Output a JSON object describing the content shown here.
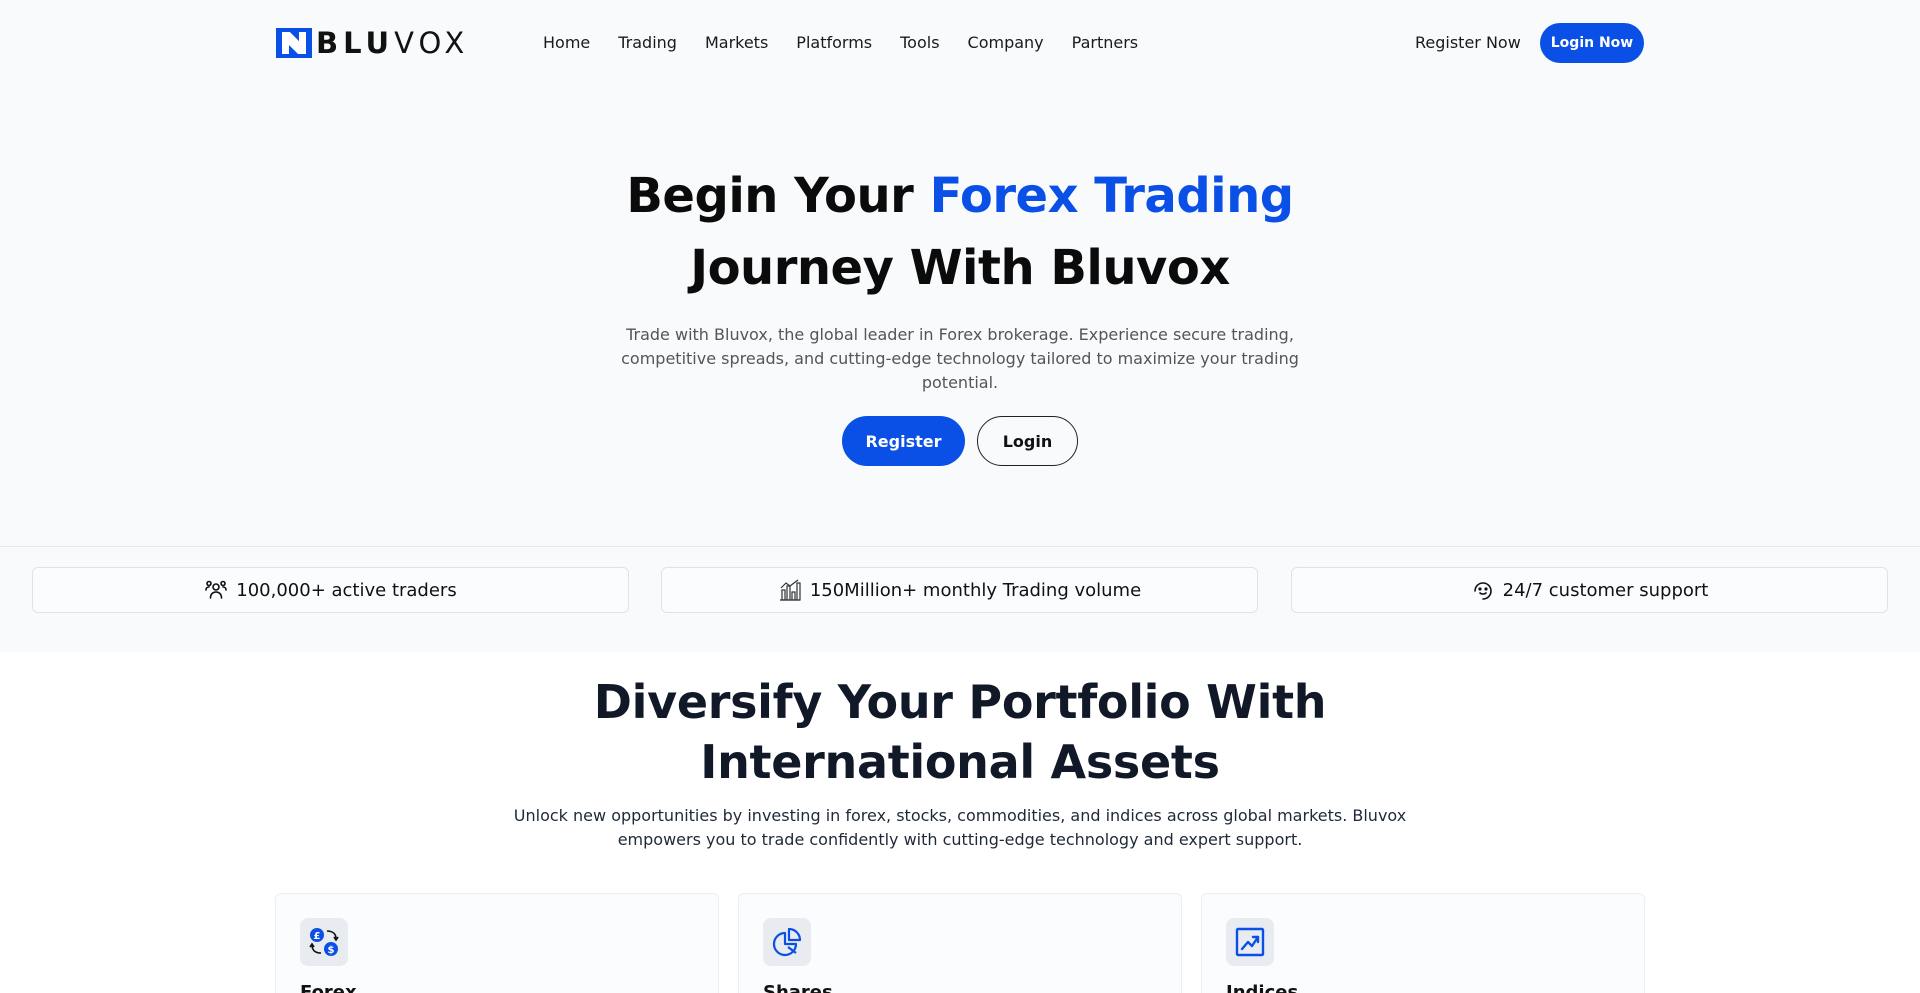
{
  "brand": {
    "name_bold": "BLU",
    "name_light": "VOX"
  },
  "nav": {
    "links": [
      "Home",
      "Trading",
      "Markets",
      "Platforms",
      "Tools",
      "Company",
      "Partners"
    ],
    "register_label": "Register Now",
    "login_label": "Login Now"
  },
  "hero": {
    "title_part1": "Begin Your ",
    "title_accent": "Forex Trading",
    "title_part2": "Journey With Bluvox",
    "subtitle": "Trade with Bluvox, the global leader in Forex brokerage. Experience secure trading, competitive spreads, and cutting-edge technology tailored to maximize your trading potential.",
    "register_label": "Register",
    "login_label": "Login"
  },
  "stats": [
    {
      "icon": "users-icon",
      "text": "100,000+ active traders"
    },
    {
      "icon": "bar-chart-icon",
      "text": "150Million+ monthly Trading volume"
    },
    {
      "icon": "support-icon",
      "text": "24/7 customer support"
    }
  ],
  "portfolio": {
    "title_line1": "Diversify Your Portfolio With",
    "title_line2": "International Assets",
    "subtitle": "Unlock new opportunities by investing in forex, stocks, commodities, and indices across global markets. Bluvox empowers you to trade confidently with cutting-edge technology and expert support.",
    "cards": [
      {
        "icon": "currency-exchange-icon",
        "label": "Forex"
      },
      {
        "icon": "pie-chart-icon",
        "label": "Shares"
      },
      {
        "icon": "trend-chart-icon",
        "label": "Indices"
      }
    ]
  },
  "colors": {
    "accent": "#0a4fe6",
    "background": "#f8fafc",
    "text": "#111111"
  }
}
